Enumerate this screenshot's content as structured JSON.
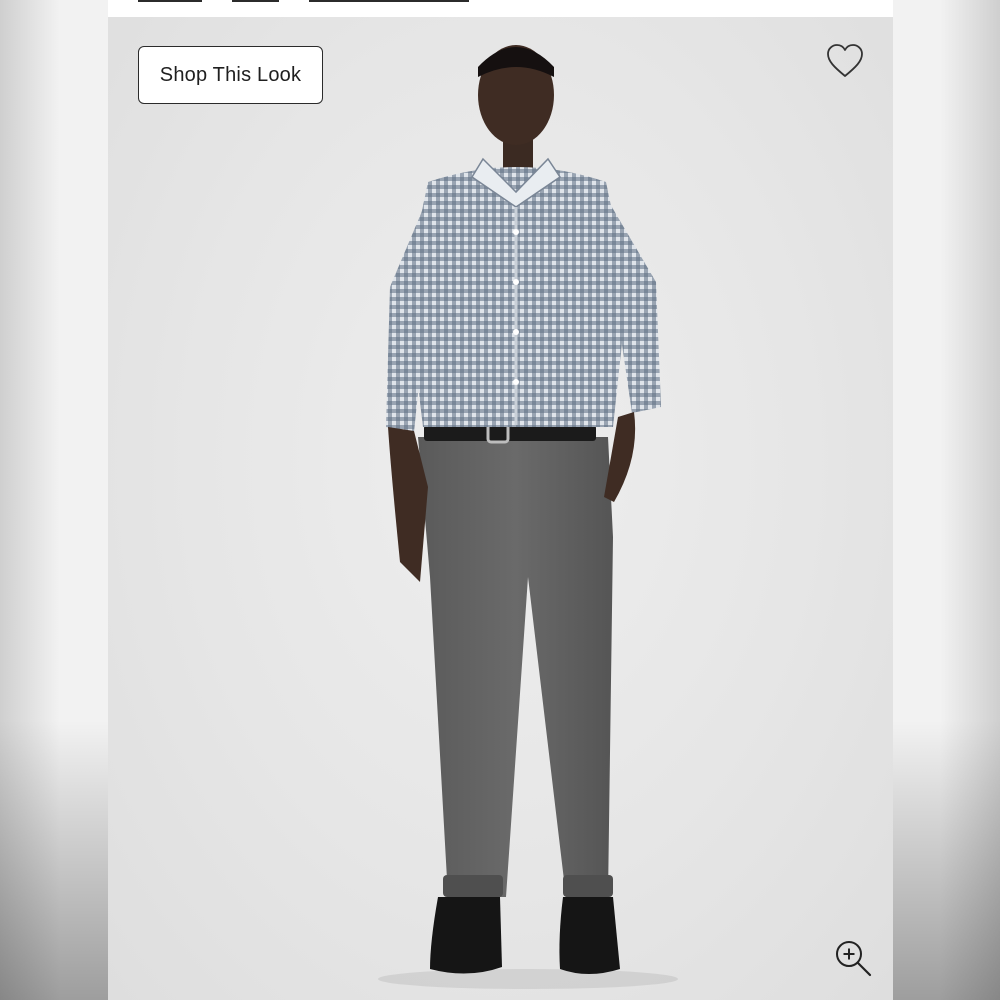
{
  "top_tabs": [
    {
      "name": "tab-1"
    },
    {
      "name": "tab-2"
    },
    {
      "name": "tab-3"
    }
  ],
  "shop_button": {
    "label": "Shop This Look"
  },
  "icons": {
    "wishlist": "heart-icon",
    "zoom": "zoom-in-icon"
  },
  "colors": {
    "page_background": "#f2f2f2",
    "photo_background": "#e8e8e8",
    "button_border": "#2b2b2b",
    "shirt": "#9aa4b3",
    "pants": "#5f5f5f",
    "shoes": "#151515"
  }
}
